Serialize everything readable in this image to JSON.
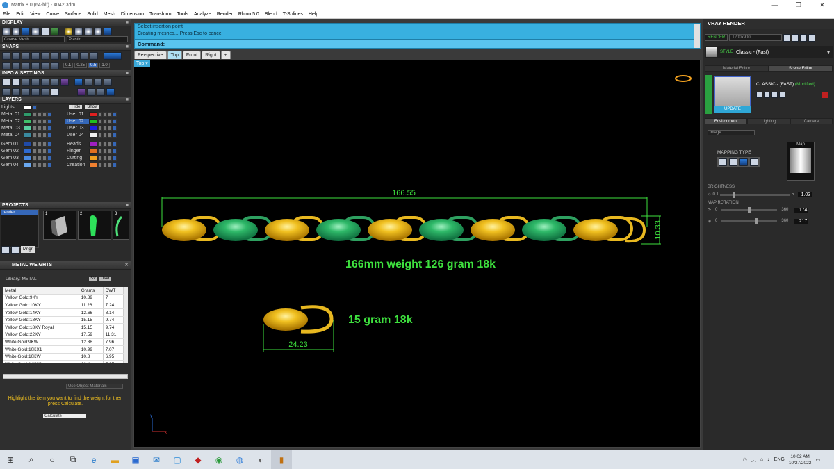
{
  "window": {
    "title": "Matrix 8.0 (64-bit) - 4042.3dm",
    "min_icon": "minimize-icon",
    "max_icon": "maximize-icon",
    "close_icon": "close-icon"
  },
  "menu": [
    "File",
    "Edit",
    "View",
    "Curve",
    "Surface",
    "Solid",
    "Mesh",
    "Dimension",
    "Transform",
    "Tools",
    "Analyze",
    "Render",
    "Rhino 5.0",
    "Blend",
    "T-Splines",
    "Help"
  ],
  "left": {
    "display": {
      "title": "DISPLAY",
      "combo1": "Coarse Mesh",
      "combo2": "Plastic"
    },
    "snaps": {
      "title": "SNAPS",
      "vals": [
        "0.1",
        "0.25",
        "0.5",
        "1.0"
      ]
    },
    "info": {
      "title": "INFO & SETTINGS"
    },
    "layers": {
      "title": "LAYERS",
      "lights": "Lights",
      "hide": "Hide",
      "show": "Show",
      "left_rows": [
        {
          "name": "Metal 01",
          "color": "#2e9a6a"
        },
        {
          "name": "Metal 02",
          "color": "#3fc06a"
        },
        {
          "name": "Metal 03",
          "color": "#5ad0a0"
        },
        {
          "name": "Metal 04",
          "color": "#3a8aa0"
        },
        {
          "name": "Gem 01",
          "color": "#1f4aa8"
        },
        {
          "name": "Gem 02",
          "color": "#2e6ad0"
        },
        {
          "name": "Gem 03",
          "color": "#4a8ae0"
        },
        {
          "name": "Gem 04",
          "color": "#6aa8f0"
        }
      ],
      "right_rows": [
        {
          "name": "User 01",
          "color": "#e02020"
        },
        {
          "name": "User 02",
          "color": "#20c020"
        },
        {
          "name": "User 03",
          "color": "#2020e0"
        },
        {
          "name": "User 04",
          "color": "#eeeeee"
        },
        {
          "name": "Heads",
          "color": "#a020c0"
        },
        {
          "name": "Finger",
          "color": "#e07020"
        },
        {
          "name": "Cutting",
          "color": "#f0a020"
        },
        {
          "name": "Creation",
          "color": "#f08030"
        }
      ]
    },
    "projects": {
      "title": "PROJECTS",
      "list": [
        "render"
      ],
      "thumbs": [
        "1",
        "2",
        "3"
      ],
      "mgr": "Mngr"
    },
    "metal_weights": {
      "title": "METAL WEIGHTS",
      "library": "Library: METAL",
      "sv": "SV",
      "user": "User",
      "headers": [
        "Metal",
        "Grams",
        "DWT"
      ],
      "rows": [
        [
          "Yellow Gold:9KY",
          "10.89",
          "7"
        ],
        [
          "Yellow Gold:10KY",
          "11.26",
          "7.24"
        ],
        [
          "Yellow Gold:14KY",
          "12.66",
          "8.14"
        ],
        [
          "Yellow Gold:18KY",
          "15.15",
          "9.74"
        ],
        [
          "Yellow Gold:18KY Royal",
          "15.15",
          "9.74"
        ],
        [
          "Yellow Gold:22KY",
          "17.59",
          "11.31"
        ],
        [
          "White Gold:9KW",
          "12.38",
          "7.96"
        ],
        [
          "White Gold:10KX1",
          "10.99",
          "7.07"
        ],
        [
          "White Gold:10KW",
          "10.8",
          "6.95"
        ],
        [
          "White Gold:14KX1",
          "12.4",
          "7.97"
        ]
      ],
      "use_object": "Use Object Materials",
      "hint": "Highlight the item you want to find the weight for then press Calculate.",
      "calc": "Calculate"
    }
  },
  "command": {
    "line1": "Select insertion point",
    "line2": "Creating meshes... Press Esc to cancel",
    "prompt": "Command:"
  },
  "tabs": [
    "Perspective",
    "Top",
    "Front",
    "Right"
  ],
  "active_tab": "Top",
  "viewport": {
    "label": "Top",
    "dim_chain": "166.55",
    "dim_height": "10.33",
    "caption_chain": "166mm weight 126 gram 18k",
    "dim_link": "24.23",
    "caption_link": "15 gram 18k",
    "axis_x": "x",
    "axis_y": "y"
  },
  "right": {
    "title": "VRAY RENDER",
    "render_btn": "RENDER",
    "size": "1200x900",
    "style_label": "STYLE",
    "style_value": "Classic - (Fast)",
    "tabs": [
      "Material Editor",
      "Scene Editor"
    ],
    "mat_name": "CLASSIC - (FAST)",
    "mat_state": "(Modified)",
    "update": "UPDATE",
    "subtabs": [
      "Environment",
      "Lighting",
      "Camera"
    ],
    "env_combo": "Image",
    "mapping_type": "MAPPING TYPE",
    "map_label": "Map",
    "brightness": {
      "label": "BRIGHTNESS",
      "min": "0.1",
      "max": "5",
      "value": "1.03"
    },
    "map_rotation": {
      "label": "MAP ROTATION",
      "min1": "0",
      "max1": "360",
      "v1": "174",
      "min2": "0",
      "max2": "360",
      "v2": "217"
    }
  },
  "taskbar": {
    "time": "10:02 AM",
    "date": "10/27/2022",
    "lang": "ENG"
  }
}
